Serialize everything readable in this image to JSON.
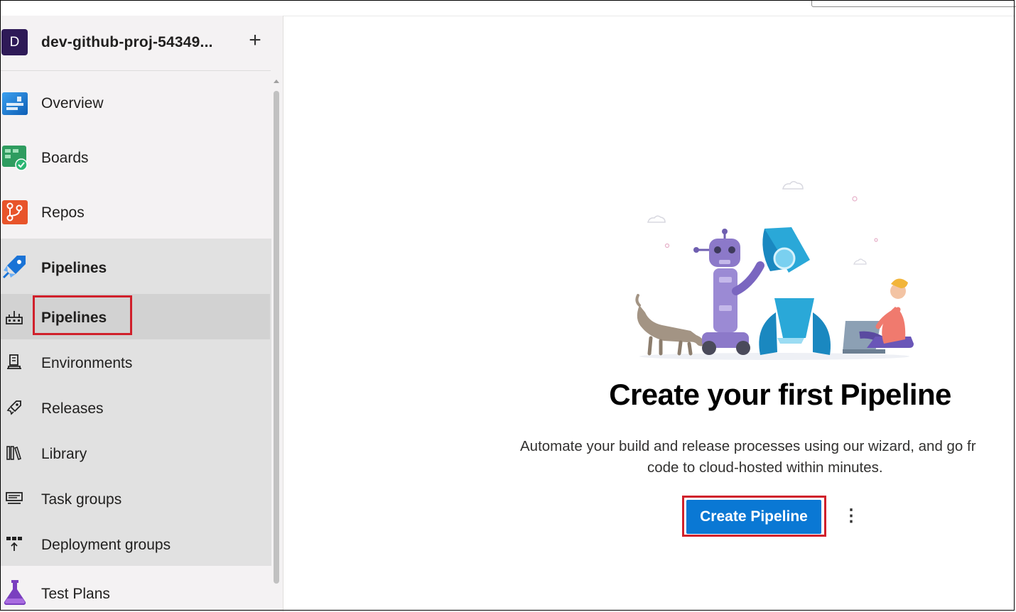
{
  "project": {
    "avatar_letter": "D",
    "name": "dev-github-proj-54349...",
    "add_symbol": "+"
  },
  "nav": {
    "overview": "Overview",
    "boards": "Boards",
    "repos": "Repos",
    "pipelines": "Pipelines",
    "test_plans": "Test Plans"
  },
  "pipelines_sub": {
    "pipelines": "Pipelines",
    "environments": "Environments",
    "releases": "Releases",
    "library": "Library",
    "task_groups": "Task groups",
    "deployment_groups": "Deployment groups"
  },
  "main": {
    "title": "Create your first Pipeline",
    "description_line1": "Automate your build and release processes using our wizard, and go fr",
    "description_line2": "code to cloud-hosted within minutes.",
    "create_button": "Create Pipeline",
    "more_symbol": "⋮"
  },
  "colors": {
    "accent": "#0a78d4",
    "highlight_border": "#d0202b",
    "project_avatar": "#2e1a57"
  }
}
